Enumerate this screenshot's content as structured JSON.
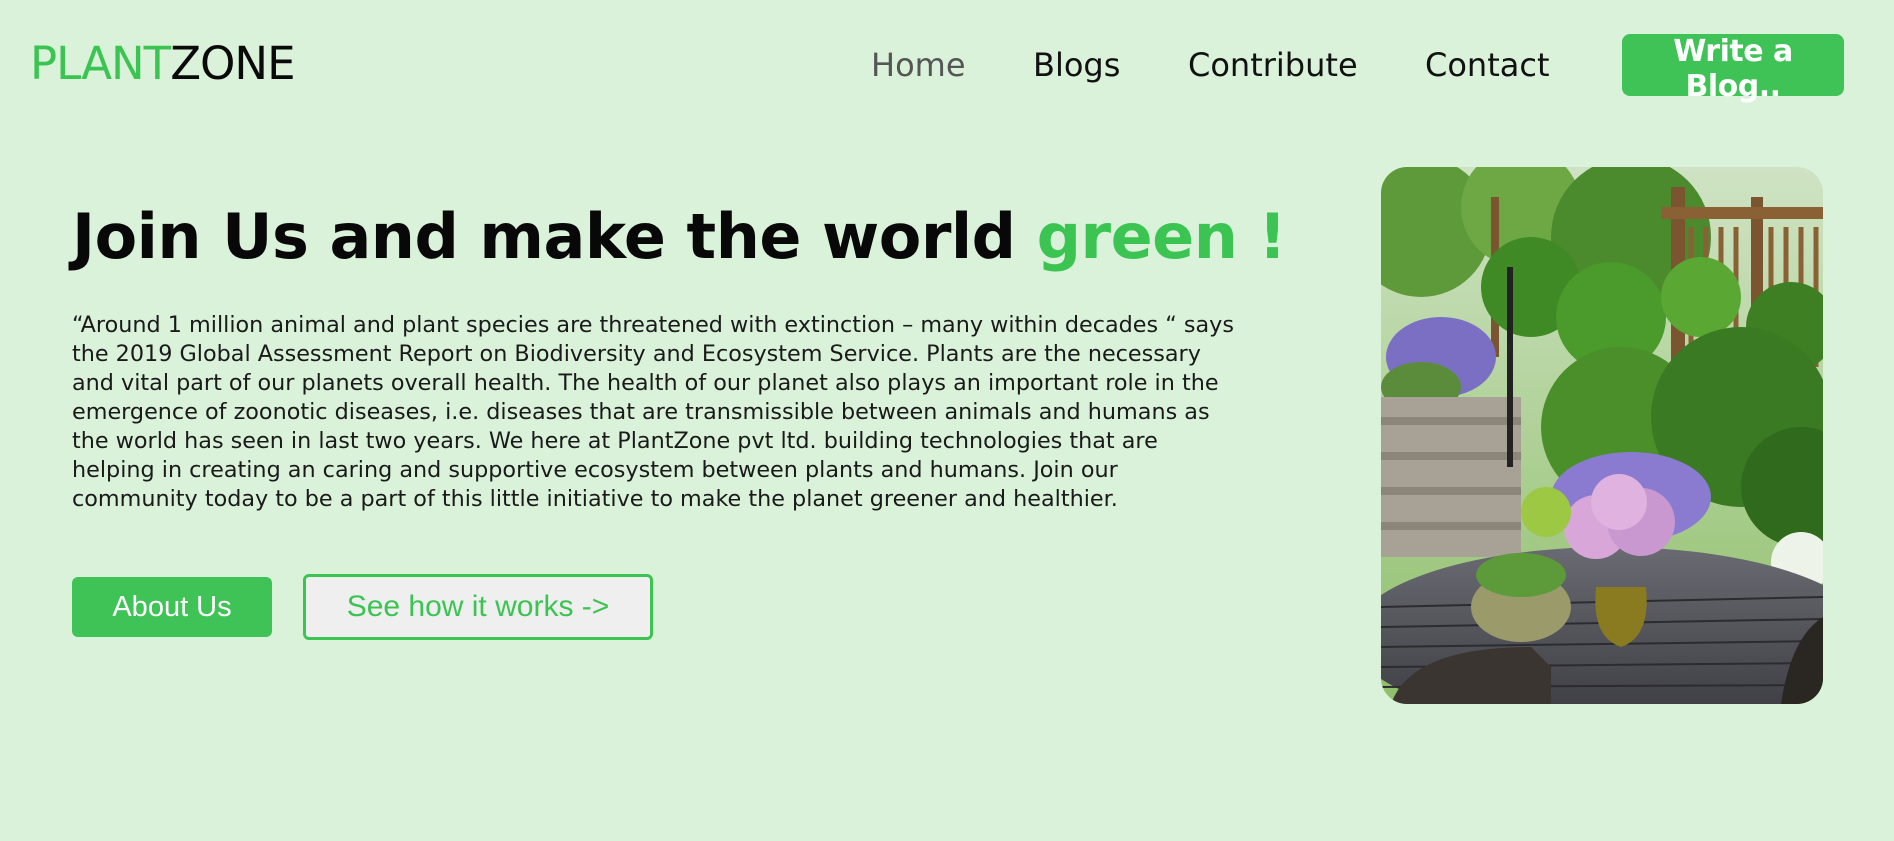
{
  "brand": {
    "part1": "PLANT",
    "part2": "ZONE"
  },
  "nav": {
    "items": [
      {
        "label": "Home",
        "active": true
      },
      {
        "label": "Blogs",
        "active": false
      },
      {
        "label": "Contribute",
        "active": false
      },
      {
        "label": "Contact",
        "active": false
      }
    ],
    "cta_label": "Write a Blog.."
  },
  "hero": {
    "title": "Join Us and make the world ",
    "title_accent": "green !",
    "lines": [
      "“Around 1 million animal and plant species are threatened with extinction – many within decades “ says",
      "the 2019 Global Assessment Report on Biodiversity and Ecosystem Service. Plants are the necessary",
      "and vital part of our planets overall health. The health of our planet also plays an important role in the",
      "emergence of zoonotic diseases, i.e. diseases that are transmissible between animals and humans as",
      "the world has seen in last two years. We here at PlantZone pvt ltd. building technologies that are",
      "helping in creating an caring and supportive ecosystem between plants and humans. Join our",
      "community today to be a part of this little initiative to make the planet greener and healthier."
    ],
    "about_label": "About Us",
    "how_label": "See how it works ->"
  },
  "colors": {
    "background": "#daf2da",
    "accent": "#3cc453",
    "text": "#080808"
  },
  "icons": {
    "hero_image": "garden-photo"
  }
}
